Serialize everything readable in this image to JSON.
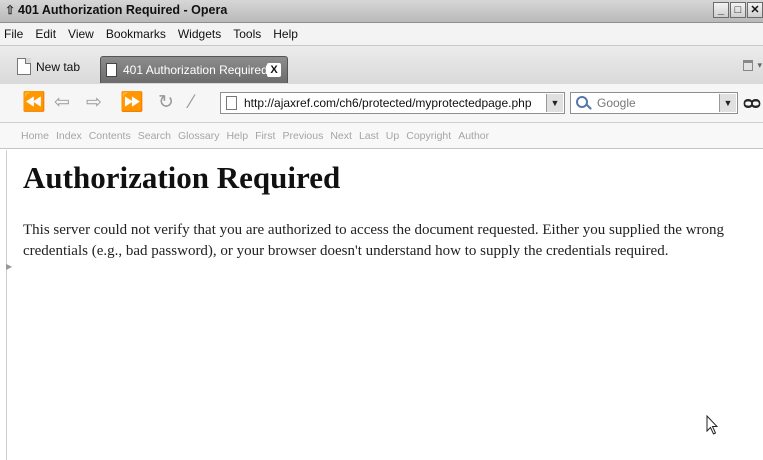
{
  "window": {
    "title": "401 Authorization Required - Opera",
    "controls": [
      "_",
      "□",
      "✕"
    ]
  },
  "menu": [
    "File",
    "Edit",
    "View",
    "Bookmarks",
    "Widgets",
    "Tools",
    "Help"
  ],
  "tabs": {
    "new_tab_label": "New tab",
    "active_tab_label": "401 Authorization Required",
    "close_glyph": "X"
  },
  "toolbar": {
    "address": "http://ajaxref.com/ch6/protected/myprotectedpage.php",
    "search_placeholder": "Google"
  },
  "nav_links": [
    "Home",
    "Index",
    "Contents",
    "Search",
    "Glossary",
    "Help",
    "First",
    "Previous",
    "Next",
    "Last",
    "Up",
    "Copyright",
    "Author"
  ],
  "page": {
    "heading": "Authorization Required",
    "message": "This server could not verify that you are authorized to access the document requested. Either you supplied the wrong credentials (e.g., bad password), or your browser doesn't understand how to supply the credentials required."
  }
}
